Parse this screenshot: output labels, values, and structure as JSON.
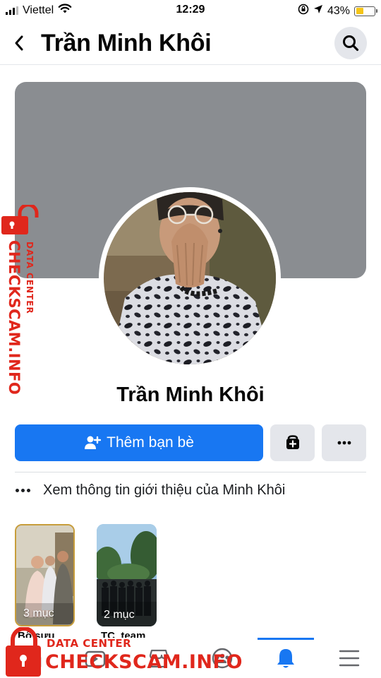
{
  "status_bar": {
    "carrier": "Viettel",
    "time": "12:29",
    "battery": "43%",
    "battery_level": 0.43,
    "icons": [
      "signal-icon",
      "wifi-icon",
      "orientation-lock-icon",
      "location-arrow-icon",
      "battery-icon"
    ]
  },
  "header": {
    "title": "Trần Minh Khôi",
    "back_icon": "chevron-left-icon",
    "search_icon": "search-icon"
  },
  "profile": {
    "name": "Trần Minh Khôi",
    "cover_color": "#8a8d91"
  },
  "actions": {
    "add_friend_label": "Thêm bạn bè",
    "add_friend_icon": "add-person-icon",
    "message_icon": "messenger-icon",
    "more_icon": "ellipsis-icon",
    "accent": "#1877f2"
  },
  "intro": {
    "text": "Xem thông tin giới thiệu của Minh Khôi"
  },
  "featured": [
    {
      "count": "3 mục",
      "label": "Bộ sưu"
    },
    {
      "count": "2 mục",
      "label": "TC_team"
    }
  ],
  "bottom_nav": {
    "items": [
      "home-icon",
      "watch-icon",
      "marketplace-icon",
      "groups-icon",
      "notifications-icon",
      "menu-icon"
    ],
    "active": "notifications-icon"
  },
  "watermark": {
    "brand": "CHECKSCAM.INFO",
    "tag": "DATA CENTER"
  }
}
